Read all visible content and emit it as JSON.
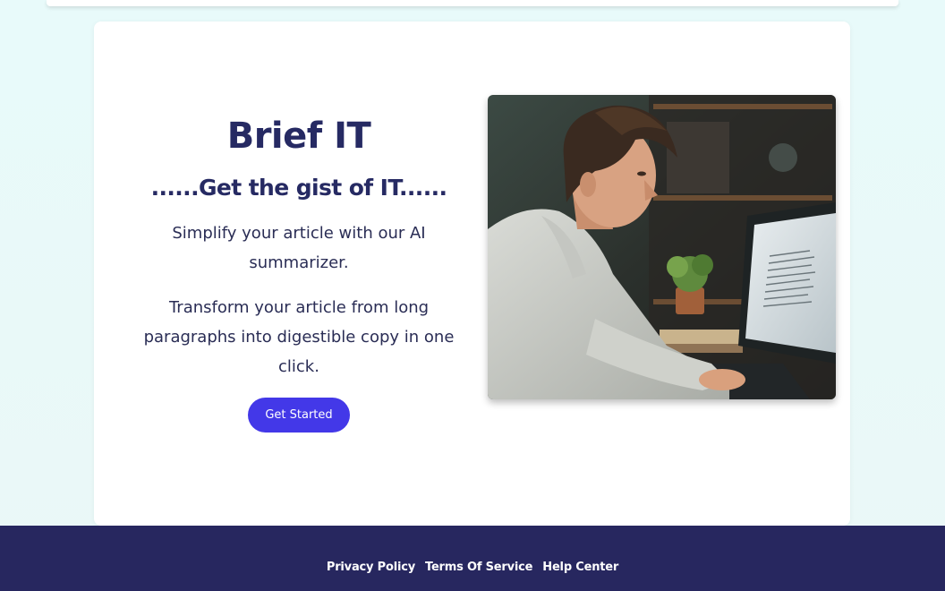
{
  "hero": {
    "title": "Brief IT",
    "tagline": "......Get the gist of IT......",
    "paragraph1": "Simplify your article with our AI summarizer.",
    "paragraph2": "Transform your article from long paragraphs into digestible copy in one click.",
    "cta_label": "Get Started",
    "image_alt": "Young man typing on a keyboard reading an article on a computer monitor"
  },
  "footer": {
    "links": [
      "Privacy Policy",
      "Terms Of Service",
      "Help Center"
    ]
  },
  "colors": {
    "background": "#e8fafa",
    "card": "#ffffff",
    "heading": "#262a63",
    "accent": "#4338e8",
    "footer": "#27275f"
  }
}
